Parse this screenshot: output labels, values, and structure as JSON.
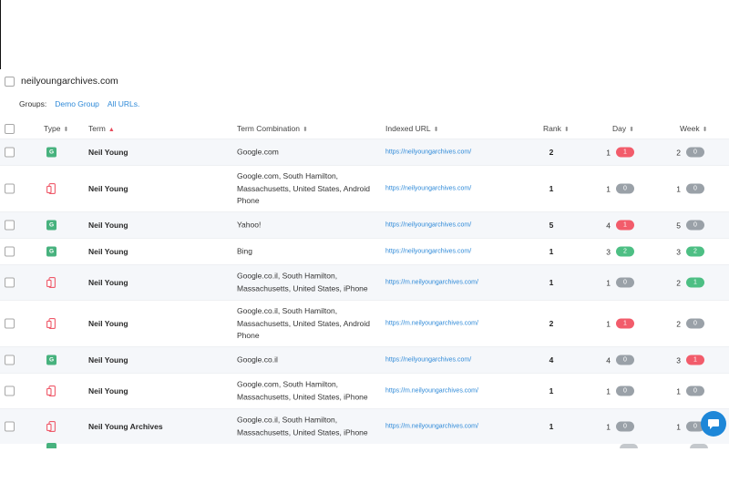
{
  "domain": {
    "name": "neilyoungarchives.com"
  },
  "groups": {
    "label": "Groups:",
    "items": [
      "Demo Group",
      "All URLs."
    ]
  },
  "columns": {
    "type": "Type",
    "term": "Term",
    "combination": "Term Combination",
    "url": "Indexed URL",
    "rank": "Rank",
    "day": "Day",
    "week": "Week"
  },
  "rows": [
    {
      "type": "google",
      "term": "Neil Young",
      "combination": "Google.com",
      "url": "https://neilyoungarchives.com/",
      "rank": "2",
      "day": "1",
      "day_badge": "1",
      "day_color": "red",
      "week": "2",
      "week_badge": "0",
      "week_color": "gray"
    },
    {
      "type": "mobile",
      "term": "Neil Young",
      "combination": "Google.com, South Hamilton, Massachusetts, United States, Android Phone",
      "url": "https://neilyoungarchives.com/",
      "rank": "1",
      "day": "1",
      "day_badge": "0",
      "day_color": "gray",
      "week": "1",
      "week_badge": "0",
      "week_color": "gray"
    },
    {
      "type": "google",
      "term": "Neil Young",
      "combination": "Yahoo!",
      "url": "https://neilyoungarchives.com/",
      "rank": "5",
      "day": "4",
      "day_badge": "1",
      "day_color": "red",
      "week": "5",
      "week_badge": "0",
      "week_color": "gray"
    },
    {
      "type": "google",
      "term": "Neil Young",
      "combination": "Bing",
      "url": "https://neilyoungarchives.com/",
      "rank": "1",
      "day": "3",
      "day_badge": "2",
      "day_color": "green",
      "week": "3",
      "week_badge": "2",
      "week_color": "green"
    },
    {
      "type": "mobile",
      "term": "Neil Young",
      "combination": "Google.co.il, South Hamilton, Massachusetts, United States, iPhone",
      "url": "https://m.neilyoungarchives.com/",
      "rank": "1",
      "day": "1",
      "day_badge": "0",
      "day_color": "gray",
      "week": "2",
      "week_badge": "1",
      "week_color": "green"
    },
    {
      "type": "mobile",
      "term": "Neil Young",
      "combination": "Google.co.il, South Hamilton, Massachusetts, United States, Android Phone",
      "url": "https://m.neilyoungarchives.com/",
      "rank": "2",
      "day": "1",
      "day_badge": "1",
      "day_color": "red",
      "week": "2",
      "week_badge": "0",
      "week_color": "gray"
    },
    {
      "type": "google",
      "term": "Neil Young",
      "combination": "Google.co.il",
      "url": "https://neilyoungarchives.com/",
      "rank": "4",
      "day": "4",
      "day_badge": "0",
      "day_color": "gray",
      "week": "3",
      "week_badge": "1",
      "week_color": "red"
    },
    {
      "type": "mobile",
      "term": "Neil Young",
      "combination": "Google.com, South Hamilton, Massachusetts, United States, iPhone",
      "url": "https://m.neilyoungarchives.com/",
      "rank": "1",
      "day": "1",
      "day_badge": "0",
      "day_color": "gray",
      "week": "1",
      "week_badge": "0",
      "week_color": "gray"
    },
    {
      "type": "mobile",
      "term": "Neil Young Archives",
      "combination": "Google.co.il, South Hamilton, Massachusetts, United States, iPhone",
      "url": "https://m.neilyoungarchives.com/",
      "rank": "1",
      "day": "1",
      "day_badge": "0",
      "day_color": "gray",
      "week": "1",
      "week_badge": "0",
      "week_color": "gray"
    }
  ],
  "icons": {
    "google": "google-search-icon",
    "mobile": "mobile-device-icon",
    "chat": "chat-icon"
  },
  "colors": {
    "link": "#2f8ad8",
    "badge_red": "#f25c6b",
    "badge_gray": "#9aa1a8",
    "badge_green": "#4dbf84",
    "chat": "#1e87d8"
  }
}
